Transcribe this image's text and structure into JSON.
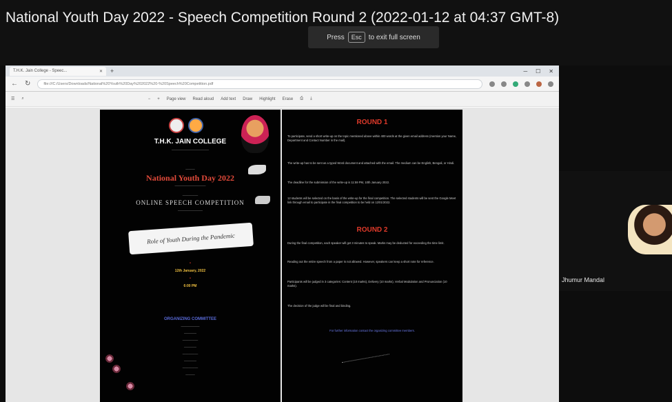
{
  "meeting": {
    "title": "National Youth Day 2022 - Speech Competition Round 2 (2022-01-12 at 04:37 GMT-8)",
    "esc_hint_prefix": "Press",
    "esc_key": "Esc",
    "esc_hint_suffix": "to exit full screen"
  },
  "browser": {
    "tab_title": "T.H.K. Jain College - Speec...",
    "url": "file:///C:/Users/Downloads/National%20Youth%20Day%202022%20-%20Speech%20Competition.pdf",
    "pdf_toolbar": {
      "page_view": "Page view",
      "read_aloud": "Read aloud",
      "add_text": "Add text",
      "draw": "Draw",
      "highlight": "Highlight",
      "erase": "Erase"
    }
  },
  "poster": {
    "college": "T.H.K. JAIN COLLEGE",
    "event": "National Youth Day 2022",
    "competition": "ONLINE SPEECH COMPETITION",
    "topic": "Role of Youth During the Pandemic",
    "date": "12th January, 2022",
    "time": "6:00 PM",
    "organizing": "ORGANIZING COMMITTEE"
  },
  "rules": {
    "round1": "ROUND 1",
    "round2": "ROUND 2",
    "round1_paragraphs": [
      "To participate, send a short write-up on the topic mentioned above within 400 words at the given email address (mention your Name, Department and Contact Number in the mail).",
      "The write-up has to be sent as a typed Word document and attached with the email. The medium can be English, Bengali, or Hindi.",
      "The deadline for the submission of the write-up is 11:59 PM, 10th January 2022.",
      "12 students will be selected on the basis of the write-up for the final competition. The selected students will be sent the Google Meet link through email to participate in the final competition to be held on 12/01/2022."
    ],
    "round2_paragraphs": [
      "During the final competition, each speaker will get 3 minutes to speak. Marks may be deducted for exceeding the time limit.",
      "Reading out the entire speech from a paper is not allowed. However, speakers can keep a short note for reference.",
      "Participants will be judged in 3 categories: Content (10 marks), Delivery (10 marks), Verbal Modulation and Pronunciation (10 marks).",
      "The decision of the judge will be final and binding."
    ],
    "footer_note": "For further information contact the organizing committee members."
  },
  "presenter": {
    "name": "Jhumur Mandal"
  }
}
